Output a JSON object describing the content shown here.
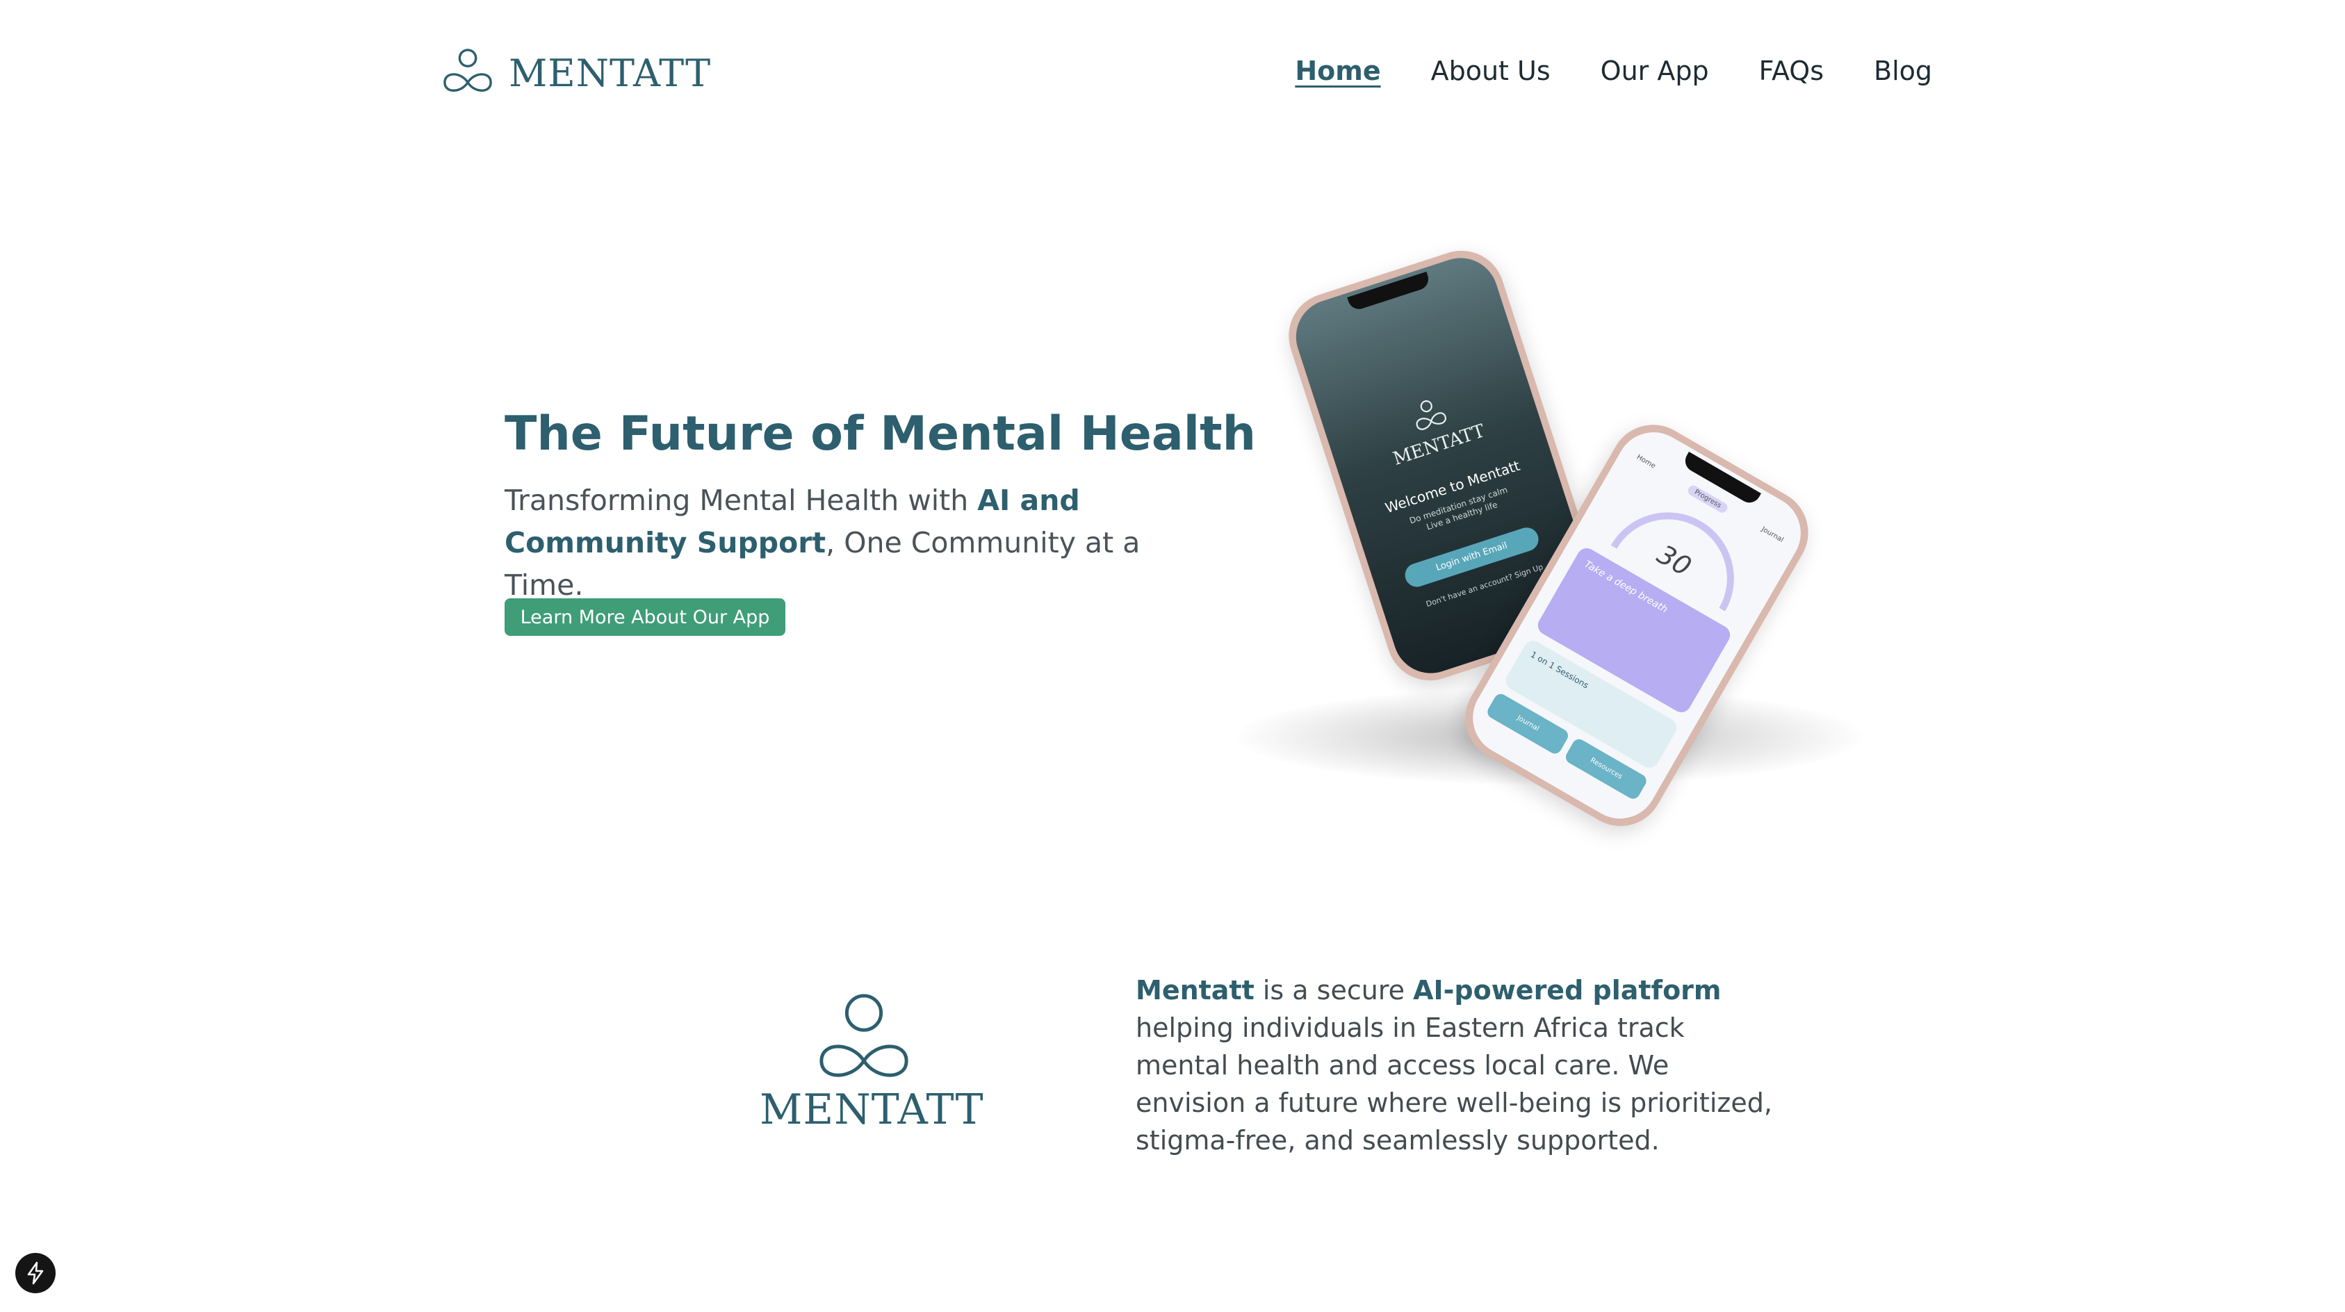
{
  "header": {
    "brand": "MENTATT",
    "nav": [
      {
        "label": "Home",
        "active": true
      },
      {
        "label": "About Us"
      },
      {
        "label": "Our App"
      },
      {
        "label": "FAQs"
      },
      {
        "label": "Blog"
      }
    ]
  },
  "hero": {
    "title": "The Future of Mental Health",
    "subtitle_pre": "Transforming Mental Health with ",
    "subtitle_highlight": "AI and Community Support",
    "subtitle_post": ", One Community at a Time.",
    "cta_label": "Learn More About Our App"
  },
  "phone_mockups": {
    "front": {
      "brand": "MENTATT",
      "welcome": "Welcome to Mentatt",
      "tagline_1": "Do meditation stay calm",
      "tagline_2": "Live a healthy life",
      "login_label": "Login with Email",
      "signup_prompt": "Don't have an account?  Sign Up"
    },
    "back": {
      "tabs": [
        "Home",
        "Progress",
        "Journal"
      ],
      "score": "30",
      "card_title": "Take a deep breath",
      "sessions_title": "1 on 1 Sessions",
      "button_1": "Journal",
      "button_2": "Resources"
    }
  },
  "about": {
    "brand": "MENTATT",
    "name": "Mentatt",
    "text_1": " is a secure ",
    "highlight": "AI-powered platform",
    "text_2": " helping individuals in Eastern Africa track mental health and access local care. We envision a future where well-being is prioritized, stigma-free, and seamlessly supported."
  },
  "colors": {
    "brand_teal": "#2d5f6e",
    "cta_green": "#3f9d78",
    "text_gray": "#444c50"
  },
  "icons": {
    "logo": "mentatt-logo-icon",
    "badge": "lightning-icon"
  }
}
